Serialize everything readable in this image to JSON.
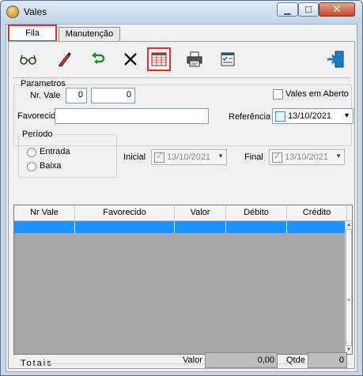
{
  "window": {
    "title": "Vales"
  },
  "tabs": [
    {
      "label": "Fila"
    },
    {
      "label": "Manutenção"
    }
  ],
  "toolbar": {
    "icons": [
      "glasses-icon",
      "pen-icon",
      "undo-icon",
      "delete-icon",
      "grid-report-icon",
      "print-icon",
      "checklist-icon",
      "exit-door-icon"
    ]
  },
  "parametros": {
    "group_label": "Parametros",
    "nr_vale_label": "Nr. Vale",
    "nr_vale_from": "0",
    "nr_vale_to": "0",
    "vales_aberto_label": "Vales em Aberto",
    "favorecido_label": "Favorecido",
    "favorecido_value": "",
    "referencia_label": "Referência",
    "referencia_value": "13/10/2021"
  },
  "periodo": {
    "group_label": "Período",
    "entrada_label": "Entrada",
    "baixa_label": "Baixa",
    "inicial_label": "Inicial",
    "inicial_value": "13/10/2021",
    "final_label": "Final",
    "final_value": "13/10/2021"
  },
  "grid": {
    "columns": [
      "Nr Vale",
      "Favorecido",
      "Valor",
      "Débito",
      "Crédito"
    ]
  },
  "totais": {
    "label": "Totais",
    "valor_label": "Valor",
    "valor_value": "0,00",
    "qtde_label": "Qtde",
    "qtde_value": "0"
  },
  "colors": {
    "accent": "#1e90ff",
    "highlight": "#e03030",
    "titlebar": "#c7d7ea"
  }
}
